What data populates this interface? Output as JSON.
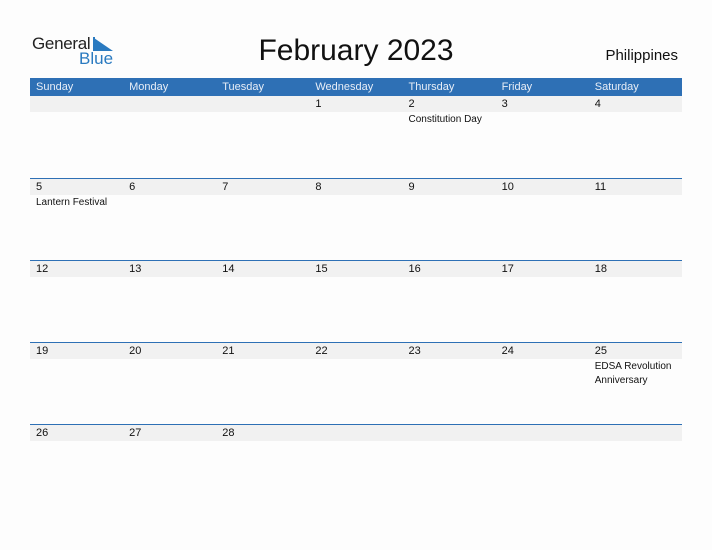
{
  "brand": {
    "word1": "General",
    "word2": "Blue",
    "color": "#2a7ac0"
  },
  "header": {
    "title": "February 2023",
    "country": "Philippines"
  },
  "colors": {
    "header_bg": "#2e70b5",
    "date_strip_bg": "#f1f1f1"
  },
  "weekdays": [
    "Sunday",
    "Monday",
    "Tuesday",
    "Wednesday",
    "Thursday",
    "Friday",
    "Saturday"
  ],
  "weeks": [
    {
      "days": [
        "",
        "",
        "",
        "1",
        "2",
        "3",
        "4"
      ],
      "events": [
        "",
        "",
        "",
        "",
        "Constitution Day",
        "",
        ""
      ]
    },
    {
      "days": [
        "5",
        "6",
        "7",
        "8",
        "9",
        "10",
        "11"
      ],
      "events": [
        "Lantern Festival",
        "",
        "",
        "",
        "",
        "",
        ""
      ]
    },
    {
      "days": [
        "12",
        "13",
        "14",
        "15",
        "16",
        "17",
        "18"
      ],
      "events": [
        "",
        "",
        "",
        "",
        "",
        "",
        ""
      ]
    },
    {
      "days": [
        "19",
        "20",
        "21",
        "22",
        "23",
        "24",
        "25"
      ],
      "events": [
        "",
        "",
        "",
        "",
        "",
        "",
        "EDSA Revolution Anniversary"
      ]
    },
    {
      "days": [
        "26",
        "27",
        "28",
        "",
        "",
        "",
        ""
      ],
      "events": [
        "",
        "",
        "",
        "",
        "",
        "",
        ""
      ]
    }
  ]
}
